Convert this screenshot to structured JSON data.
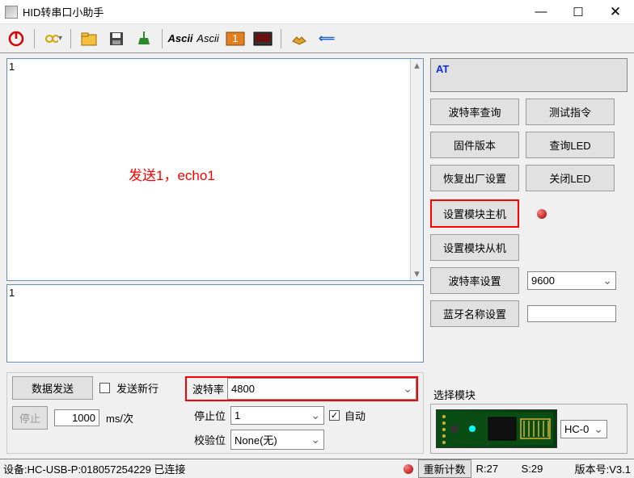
{
  "window": {
    "title": "HID转串口小助手"
  },
  "rx": {
    "text": "1",
    "annotation": "发送1，echo1"
  },
  "tx": {
    "text": "1"
  },
  "controls": {
    "send_label": "数据发送",
    "newline_label": "发送新行",
    "newline_checked": false,
    "stop_label": "停止",
    "interval_value": "1000",
    "interval_unit": "ms/次",
    "baud_label": "波特率",
    "baud_value": "4800",
    "stopbits_label": "停止位",
    "stopbits_value": "1",
    "auto_label": "自动",
    "auto_checked": true,
    "parity_label": "校验位",
    "parity_value": "None(无)"
  },
  "right": {
    "at_text": "AT",
    "btn_baud_query": "波特率查询",
    "btn_test_cmd": "测试指令",
    "btn_fw_version": "固件版本",
    "btn_query_led": "查询LED",
    "btn_factory_reset": "恢复出厂设置",
    "btn_close_led": "关闭LED",
    "btn_set_master": "设置模块主机",
    "btn_set_slave": "设置模块从机",
    "btn_baud_set": "波特率设置",
    "baud_set_value": "9600",
    "btn_bt_name": "蓝牙名称设置",
    "bt_name_value": "",
    "module_select_label": "选择模块",
    "module_value": "HC-0"
  },
  "status": {
    "device": "设备:HC-USB-P:018057254229 已连接",
    "reset_count_label": "重新计数",
    "r": "R:27",
    "s": "S:29",
    "version": "版本号:V3.1"
  }
}
